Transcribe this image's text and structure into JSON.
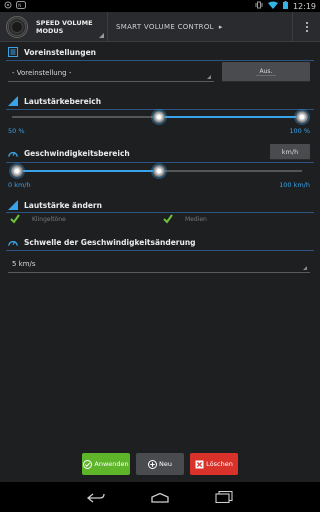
{
  "status_bar": {
    "time": "12:19",
    "left_icons": [
      "settings-icon",
      "nfc-icon"
    ],
    "right_icons": [
      "vibrate-icon",
      "wifi-icon",
      "battery-icon"
    ]
  },
  "app": {
    "title_line1": "SPEED VOLUME",
    "title_line2": "MODUS",
    "nav_title": "SMART VOLUME CONTROL",
    "nav_arrow": "▸"
  },
  "presets": {
    "header": "Voreinstellungen",
    "spinner_value": "- Voreinstellung -",
    "button_label": "Aus."
  },
  "volume_range": {
    "header": "Lautstärkebereich",
    "min_label": "50 %",
    "max_label": "100 %",
    "min_value": 50,
    "max_value": 100
  },
  "speed_range": {
    "header": "Geschwindigkeitsbereich",
    "unit_button": "km/h",
    "min_label": "0 km/h",
    "max_label": "100 km/h",
    "min_value": 0,
    "max_value": 100,
    "current_value": 50
  },
  "change_volume": {
    "header": "Lautstärke ändern",
    "ringtones": {
      "label": "Klingeltöne",
      "checked": true
    },
    "media": {
      "label": "Medien",
      "checked": true
    }
  },
  "threshold": {
    "header": "Schwelle der Geschwindigkeitsänderung",
    "value": "5 km/s"
  },
  "footer": {
    "apply": "Anwenden",
    "new": "Neu",
    "delete": "Löschen"
  },
  "colors": {
    "accent": "#3aa3e8",
    "apply": "#5fb52a",
    "delete": "#d9322b",
    "new": "#4a4b4e"
  }
}
